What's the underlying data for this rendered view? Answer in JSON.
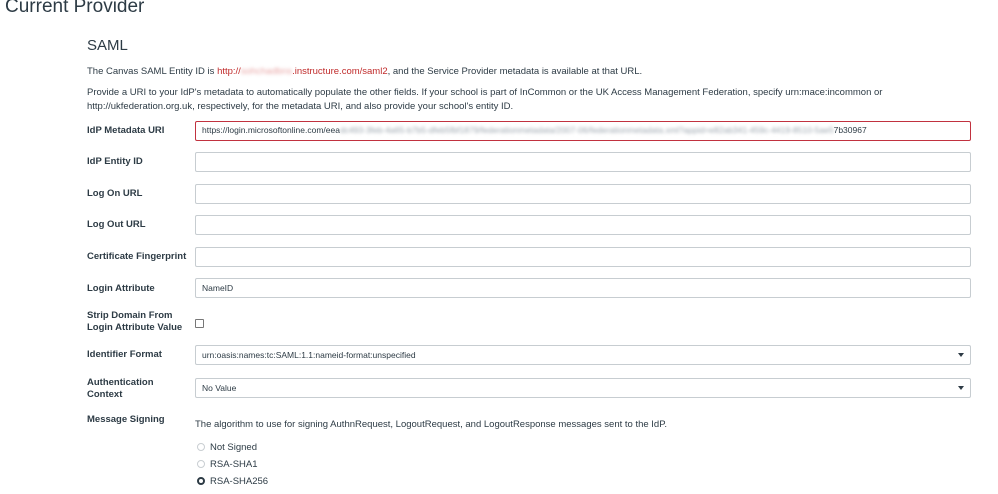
{
  "page_title": "Current Provider",
  "section_title": "SAML",
  "description1": {
    "prefix": "The Canvas SAML Entity ID is ",
    "link_start": "http://",
    "link_blurred": "sohchadbns",
    "link_end": ".instructure.com/saml2",
    "suffix": ", and the Service Provider metadata is available at that URL."
  },
  "description2": "Provide a URI to your IdP's metadata to automatically populate the other fields. If your school is part of InCommon or the UK Access Management Federation, specify urn:mace:incommon or http://ukfederation.org.uk, respectively, for the metadata URI, and also provide your school's entity ID.",
  "fields": {
    "idp_metadata_uri": {
      "label": "IdP Metadata URI",
      "value_start": "https://login.microsoftonline.com/eea",
      "value_blurred": "dc493-3feb-4a65-b7b5-dfeb5fbf1879/federationmetadata/2007-06/federationmetadata.xml?appid=e82ab341-459c-4419-8510-5ae5",
      "value_end": "7b30967"
    },
    "idp_entity_id": {
      "label": "IdP Entity ID",
      "value": ""
    },
    "log_on_url": {
      "label": "Log On URL",
      "value": ""
    },
    "log_out_url": {
      "label": "Log Out URL",
      "value": ""
    },
    "certificate_fingerprint": {
      "label": "Certificate Fingerprint",
      "value": ""
    },
    "login_attribute": {
      "label": "Login Attribute",
      "value": "NameID"
    },
    "strip_domain": {
      "label": "Strip Domain From Login Attribute Value",
      "checked": false
    },
    "identifier_format": {
      "label": "Identifier Format",
      "value": "urn:oasis:names:tc:SAML:1.1:nameid-format:unspecified"
    },
    "authentication_context": {
      "label": "Authentication Context",
      "value": "No Value"
    },
    "message_signing": {
      "label": "Message Signing",
      "help": "The algorithm to use for signing AuthnRequest, LogoutRequest, and LogoutResponse messages sent to the IdP.",
      "options": [
        {
          "label": "Not Signed",
          "selected": false
        },
        {
          "label": "RSA-SHA1",
          "selected": false
        },
        {
          "label": "RSA-SHA256",
          "selected": true
        }
      ]
    }
  },
  "colors": {
    "text": "#2d3b45",
    "link": "#c02b2b",
    "error_border": "#c1323f",
    "input_border": "#c7cdd1"
  }
}
